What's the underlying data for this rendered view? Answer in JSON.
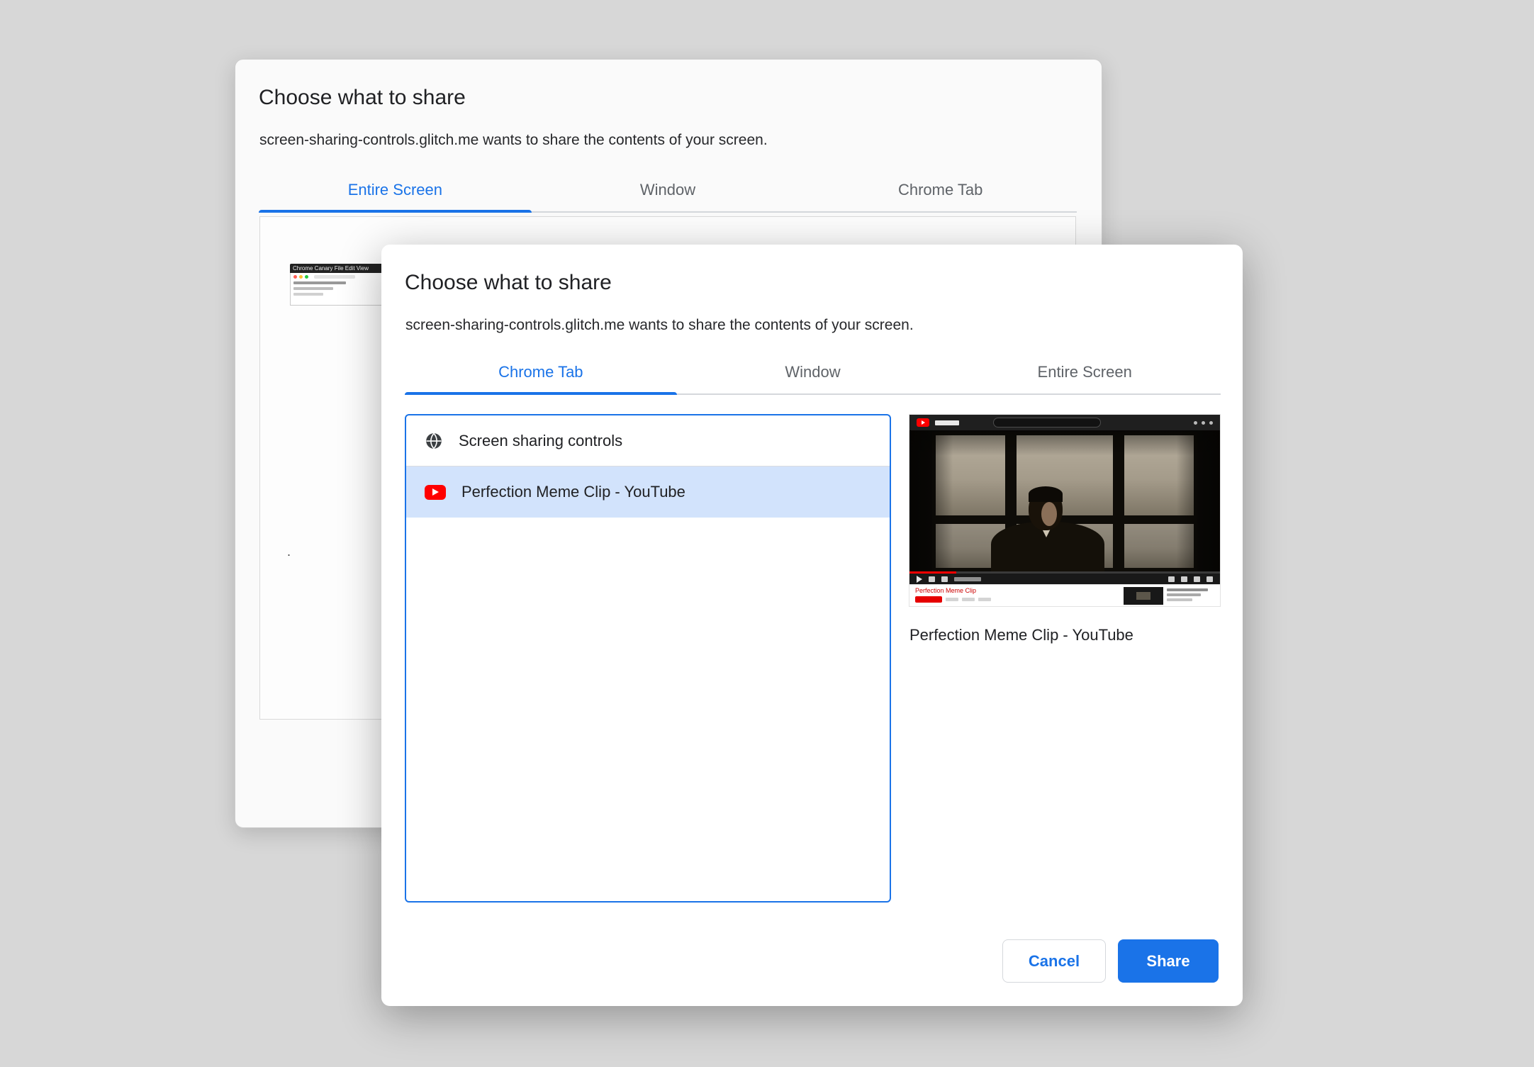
{
  "colors": {
    "accent": "#1a73e8",
    "selected_row": "#d2e3fc",
    "youtube_red": "#ff0000"
  },
  "back_dialog": {
    "title": "Choose what to share",
    "subtitle": "screen-sharing-controls.glitch.me wants to share the contents of your screen.",
    "active_tab": "Entire Screen",
    "tabs": [
      {
        "label": "Entire Screen"
      },
      {
        "label": "Window"
      },
      {
        "label": "Chrome Tab"
      }
    ],
    "thumbnail_menubar": "Chrome Canary   File   Edit   View",
    "stray_mark": "."
  },
  "front_dialog": {
    "title": "Choose what to share",
    "subtitle": "screen-sharing-controls.glitch.me wants to share the contents of your screen.",
    "active_tab": "Chrome Tab",
    "tabs": [
      {
        "label": "Chrome Tab"
      },
      {
        "label": "Window"
      },
      {
        "label": "Entire Screen"
      }
    ],
    "items": [
      {
        "label": "Screen sharing controls",
        "icon": "globe-icon",
        "selected": false
      },
      {
        "label": "Perfection Meme Clip - YouTube",
        "icon": "youtube-icon",
        "selected": true
      }
    ],
    "preview_caption": "Perfection Meme Clip - YouTube",
    "preview_page_title": "Perfection Meme Clip",
    "cancel_label": "Cancel",
    "share_label": "Share"
  }
}
